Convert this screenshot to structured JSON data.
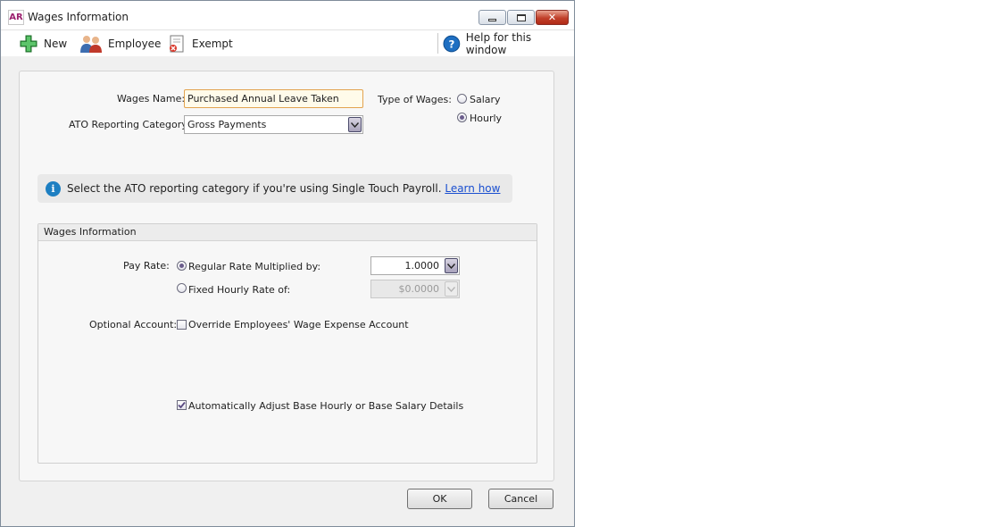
{
  "window": {
    "title": "Wages Information",
    "app_icon_text": "AR"
  },
  "toolbar": {
    "new_label": "New",
    "employee_label": "Employee",
    "exempt_label": "Exempt",
    "help_label": "Help for this window"
  },
  "form": {
    "wages_name_label": "Wages Name:",
    "wages_name_value": "Purchased Annual Leave Taken",
    "ato_label": "ATO Reporting Category:",
    "ato_value": "Gross Payments",
    "type_label": "Type of Wages:",
    "type_options": [
      {
        "label": "Salary",
        "selected": false
      },
      {
        "label": "Hourly",
        "selected": true
      }
    ]
  },
  "info": {
    "icon": "info-icon",
    "text": "Select the ATO reporting category if you're using Single Touch Payroll.",
    "link": "Learn how"
  },
  "wages_info": {
    "title": "Wages Information",
    "pay_rate_label": "Pay Rate:",
    "regular_label": "Regular Rate Multiplied by:",
    "regular_selected": true,
    "regular_value": "1.0000",
    "fixed_label": "Fixed Hourly Rate of:",
    "fixed_selected": false,
    "fixed_value": "$0.0000",
    "optional_label": "Optional Account:",
    "override_label": "Override Employees' Wage Expense Account",
    "override_checked": false,
    "auto_adjust_label": "Automatically Adjust Base Hourly or Base Salary Details",
    "auto_adjust_checked": true
  },
  "buttons": {
    "ok": "OK",
    "cancel": "Cancel"
  },
  "colors": {
    "accent_purple": "#6b5d8c",
    "field_highlight": "#fffbea",
    "link_blue": "#1a4fd0",
    "info_blue": "#1d7fc2"
  }
}
